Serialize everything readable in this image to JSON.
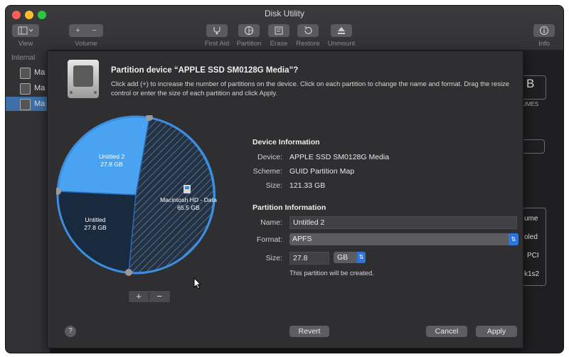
{
  "window": {
    "title": "Disk Utility"
  },
  "toolbar": {
    "view_label": "View",
    "volume_label": "Volume",
    "first_aid_label": "First Aid",
    "partition_label": "Partition",
    "erase_label": "Erase",
    "restore_label": "Restore",
    "unmount_label": "Unmount",
    "info_label": "Info",
    "add_glyph": "+",
    "remove_glyph": "−"
  },
  "sidebar": {
    "header": "Internal",
    "items": [
      {
        "label": "Ma"
      },
      {
        "label": "Ma"
      },
      {
        "label": "Ma"
      }
    ]
  },
  "background": {
    "fragments": [
      "B",
      "UMES",
      "ume",
      "oled",
      "PCI",
      "k1s2"
    ]
  },
  "sheet": {
    "title": "Partition device “APPLE SSD SM0128G Media”?",
    "description": "Click add (+) to increase the number of partitions on the device. Click on each partition to change the name and format. Drag the resize control or enter the size of each partition and click Apply.",
    "pie": {
      "slices": [
        {
          "name": "Untitled 2",
          "size": "27.8 GB",
          "color": "#4aa3f0"
        },
        {
          "name": "Untitled",
          "size": "27.8 GB",
          "color": "#1a2a3e"
        },
        {
          "name": "Macintosh HD - Data",
          "size": "65.5 GB",
          "color": "#263548"
        }
      ]
    },
    "add_button": "+",
    "remove_button": "−",
    "device_info": {
      "heading": "Device Information",
      "device_label": "Device:",
      "device_value": "APPLE SSD SM0128G Media",
      "scheme_label": "Scheme:",
      "scheme_value": "GUID Partition Map",
      "size_label": "Size:",
      "size_value": "121.33 GB"
    },
    "partition_info": {
      "heading": "Partition Information",
      "name_label": "Name:",
      "name_value": "Untitled 2",
      "format_label": "Format:",
      "format_value": "APFS",
      "size_label": "Size:",
      "size_value": "27.8",
      "unit_value": "GB",
      "note": "This partition will be created."
    },
    "help": "?",
    "revert_label": "Revert",
    "cancel_label": "Cancel",
    "apply_label": "Apply"
  },
  "colors": {
    "accent": "#2f74d8",
    "selected_slice": "#4aa3f0"
  }
}
